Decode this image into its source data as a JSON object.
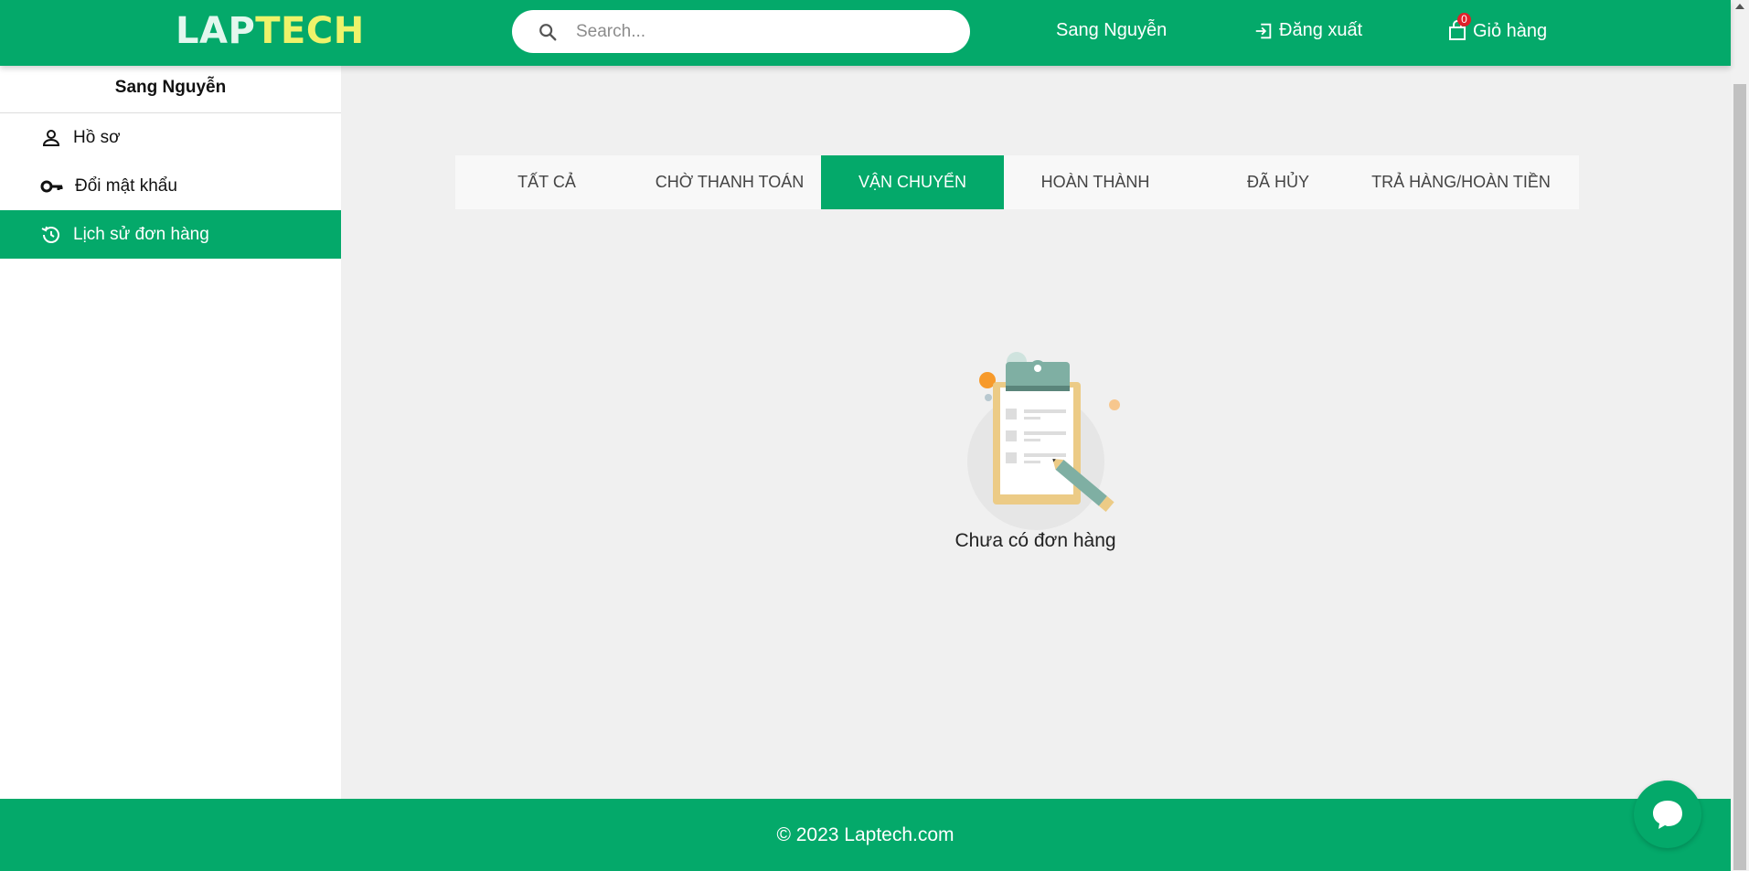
{
  "header": {
    "logo_part1": "LAP",
    "logo_part2": "TECH",
    "search_placeholder": "Search...",
    "user_name": "Sang Nguyễn",
    "logout_label": "Đăng xuất",
    "cart_label": "Giỏ hàng",
    "cart_count": "0"
  },
  "sidebar": {
    "user_name": "Sang Nguyễn",
    "items": [
      {
        "label": "Hồ sơ",
        "icon": "person-icon"
      },
      {
        "label": "Đổi mật khẩu",
        "icon": "key-icon"
      },
      {
        "label": "Lịch sử đơn hàng",
        "icon": "history-icon",
        "active": true
      }
    ]
  },
  "tabs": [
    {
      "label": "TẤT CẢ"
    },
    {
      "label": "CHỜ THANH TOÁN"
    },
    {
      "label": "VẬN CHUYỂN",
      "active": true
    },
    {
      "label": "HOÀN THÀNH"
    },
    {
      "label": "ĐÃ HỦY"
    },
    {
      "label": "TRẢ HÀNG/HOÀN TIỀN"
    }
  ],
  "empty_state": {
    "message": "Chưa có đơn hàng",
    "illustration": "clipboard-icon"
  },
  "footer": {
    "copyright": "© 2023 Laptech.com"
  },
  "chat": {
    "icon": "chat-icon"
  },
  "colors": {
    "brand_green": "#04a96a",
    "logo_yellow": "#eef36a",
    "background": "#f0f0f0"
  }
}
